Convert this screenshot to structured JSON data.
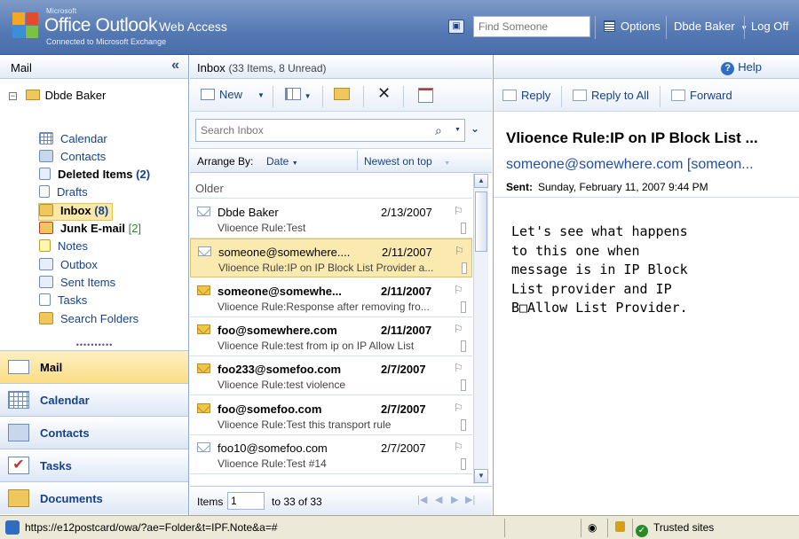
{
  "header": {
    "brand_small": "Microsoft",
    "brand_title": "Office Outlook",
    "brand_suffix": "Web Access",
    "brand_sub": "Connected to Microsoft Exchange",
    "find_placeholder": "Find Someone",
    "options_label": "Options",
    "user_label": "Dbde Baker",
    "logoff_label": "Log Off"
  },
  "left": {
    "title": "Mail",
    "root": "Dbde Baker",
    "folders": [
      {
        "label": "Calendar",
        "count": ""
      },
      {
        "label": "Contacts",
        "count": ""
      },
      {
        "label": "Deleted Items",
        "count": "(2)"
      },
      {
        "label": "Drafts",
        "count": ""
      },
      {
        "label": "Inbox",
        "count": "(8)"
      },
      {
        "label": "Junk E-mail",
        "count": "[2]"
      },
      {
        "label": "Notes",
        "count": ""
      },
      {
        "label": "Outbox",
        "count": ""
      },
      {
        "label": "Sent Items",
        "count": ""
      },
      {
        "label": "Tasks",
        "count": ""
      },
      {
        "label": "Search Folders",
        "count": ""
      }
    ],
    "nav": [
      "Mail",
      "Calendar",
      "Contacts",
      "Tasks",
      "Documents"
    ]
  },
  "mid": {
    "title": "Inbox",
    "subtitle": "(33 Items, 8 Unread)",
    "new_label": "New",
    "search_placeholder": "Search Inbox",
    "arrange_label": "Arrange By:",
    "arrange_value": "Date",
    "order_value": "Newest on top",
    "group": "Older",
    "messages": [
      {
        "from": "Dbde Baker",
        "date": "2/13/2007",
        "subject": "Vlioence Rule:Test",
        "unread": false,
        "selected": false
      },
      {
        "from": "someone@somewhere....",
        "date": "2/11/2007",
        "subject": "Vlioence Rule:IP on IP Block List Provider a...",
        "unread": false,
        "selected": true
      },
      {
        "from": "someone@somewhe...",
        "date": "2/11/2007",
        "subject": "Vlioence Rule:Response after removing fro...",
        "unread": true,
        "selected": false
      },
      {
        "from": "foo@somewhere.com",
        "date": "2/11/2007",
        "subject": "Vlioence Rule:test from ip on IP Allow List",
        "unread": true,
        "selected": false
      },
      {
        "from": "foo233@somefoo.com",
        "date": "2/7/2007",
        "subject": "Vlioence Rule:test violence",
        "unread": true,
        "selected": false
      },
      {
        "from": "foo@somefoo.com",
        "date": "2/7/2007",
        "subject": "Vlioence Rule:Test this transport rule",
        "unread": true,
        "selected": false
      },
      {
        "from": "foo10@somefoo.com",
        "date": "2/7/2007",
        "subject": "Vlioence Rule:Test #14",
        "unread": false,
        "selected": false
      }
    ],
    "pager_label": "Items",
    "pager_value": "1",
    "pager_range": "to 33 of 33"
  },
  "read": {
    "help_label": "Help",
    "reply_label": "Reply",
    "reply_all_label": "Reply to All",
    "forward_label": "Forward",
    "subject": "Vlioence Rule:IP on IP Block List ...",
    "sender": "someone@somewhere.com [someon...",
    "sent_label": "Sent:",
    "sent_value": "Sunday, February 11, 2007 9:44 PM",
    "body": "Let's see what happens\nto this one when\nmessage is in IP Block\nList provider and IP\nB□Allow List Provider."
  },
  "status": {
    "url": "https://e12postcard/owa/?ae=Folder&t=IPF.Note&a=#",
    "zone": "Trusted sites"
  }
}
